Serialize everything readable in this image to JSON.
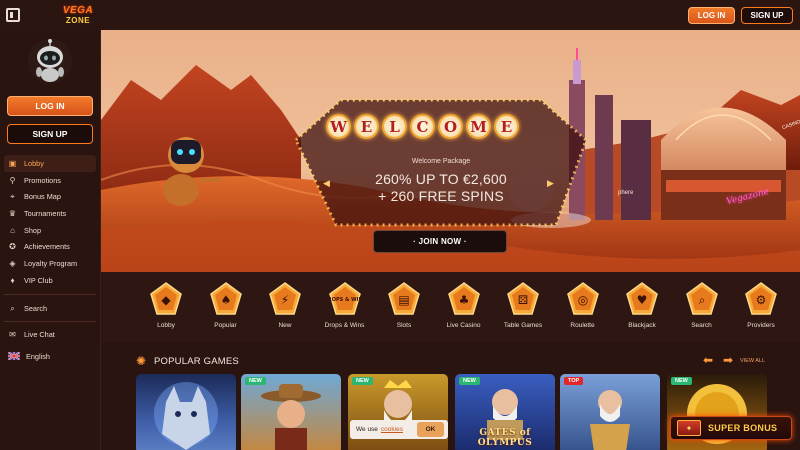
{
  "header": {
    "logo": "VEGAZONE",
    "login_label": "LOG IN",
    "signup_label": "SIGN UP"
  },
  "sidebar": {
    "login_label": "LOG IN",
    "signup_label": "SIGN UP",
    "items": [
      {
        "label": "Lobby",
        "icon": "lobby-icon",
        "active": true
      },
      {
        "label": "Promotions",
        "icon": "promotions-icon"
      },
      {
        "label": "Bonus Map",
        "icon": "bonus-map-icon"
      },
      {
        "label": "Tournaments",
        "icon": "tournaments-icon"
      },
      {
        "label": "Shop",
        "icon": "shop-icon"
      },
      {
        "label": "Achievements",
        "icon": "achievements-icon"
      },
      {
        "label": "Loyalty Program",
        "icon": "loyalty-icon"
      },
      {
        "label": "VIP Club",
        "icon": "vip-icon"
      }
    ],
    "search_label": "Search",
    "live_chat_label": "Live Chat",
    "language_label": "English"
  },
  "hero": {
    "welcome_letters": [
      "W",
      "E",
      "L",
      "C",
      "O",
      "M",
      "E"
    ],
    "package_label": "Welcome Package",
    "line1": "260% UP TO €2,600",
    "line2": "+ 260 FREE SPINS",
    "join_label": "· JOIN NOW ·",
    "sign_text": "Vegazone",
    "casino_text": "CASINO",
    "sphere_text": "phere"
  },
  "categories": [
    {
      "label": "Lobby",
      "icon": "lobby-icon"
    },
    {
      "label": "Popular",
      "icon": "cards-icon"
    },
    {
      "label": "New",
      "icon": "lightning-icon"
    },
    {
      "label": "Drops & Wins",
      "icon": "drops-wins-icon",
      "badge": "DROPS & WINS"
    },
    {
      "label": "Slots",
      "icon": "slot-machine-icon"
    },
    {
      "label": "Live Casino",
      "icon": "live-casino-icon"
    },
    {
      "label": "Table Games",
      "icon": "dice-icon"
    },
    {
      "label": "Roulette",
      "icon": "roulette-icon"
    },
    {
      "label": "Blackjack",
      "icon": "blackjack-icon"
    },
    {
      "label": "Search",
      "icon": "telescope-icon"
    },
    {
      "label": "Providers",
      "icon": "providers-icon"
    }
  ],
  "popular": {
    "title": "POPULAR GAMES",
    "view_all": "VIEW ALL",
    "games": [
      {
        "badge": "",
        "title": "",
        "theme": "wolf"
      },
      {
        "badge": "NEW",
        "title": "",
        "theme": "cowboy"
      },
      {
        "badge": "NEW",
        "title": "",
        "theme": "gods"
      },
      {
        "badge": "NEW",
        "title": "GATES of OLYMPUS",
        "theme": "olympus"
      },
      {
        "badge": "TOP",
        "title": "",
        "theme": "zeus"
      },
      {
        "badge": "NEW",
        "title": "",
        "theme": "gold"
      }
    ]
  },
  "cookie": {
    "text": "We use",
    "link": "cookies",
    "ok_label": "OK"
  },
  "super_bonus": {
    "label": "SUPER BONUS"
  },
  "colors": {
    "accent": "#f27b2a",
    "background": "#2a1410",
    "badge_new": "#2bb673",
    "badge_top": "#e2262a"
  }
}
